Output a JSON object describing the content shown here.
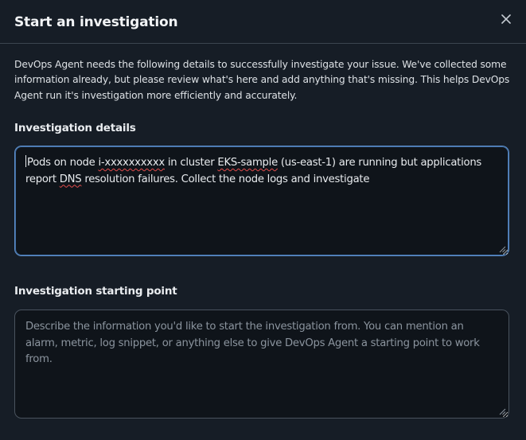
{
  "modal": {
    "title": "Start an investigation",
    "close_icon": "close-icon"
  },
  "intro": {
    "text": "DevOps Agent needs the following details to successfully investigate your issue. We've collected some information already, but please review what's here and add anything that's missing. This helps DevOps Agent run it's investigation more efficiently and accurately."
  },
  "investigation_details": {
    "label": "Investigation details",
    "value_parts": [
      "Pods on node ",
      "i-xxxxxxxxxx",
      " in cluster ",
      "EKS-sample",
      " (us-east-1) are running but applications report ",
      "DNS",
      " resolution failures. Collect the node logs and investigate"
    ]
  },
  "starting_point": {
    "label": "Investigation starting point",
    "value": "",
    "placeholder": "Describe the information you'd like to start the investigation from. You can mention an alarm, metric, log snippet, or anything else to give DevOps Agent a starting point to work from."
  },
  "colors": {
    "background": "#161d26",
    "input_background": "#0f141a",
    "focus_border": "#5f8fc9",
    "border": "#4a535e",
    "spellcheck": "#e24c4c"
  }
}
